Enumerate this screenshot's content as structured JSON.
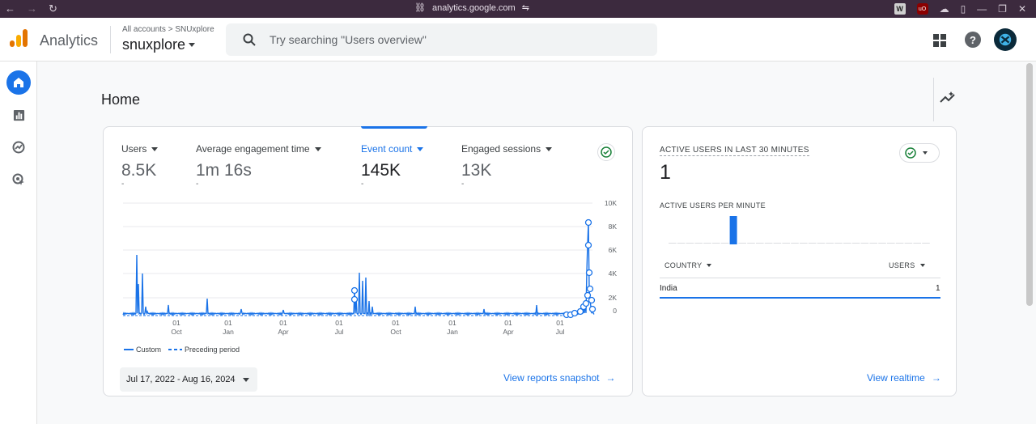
{
  "browser": {
    "url": "analytics.google.com",
    "ext_w": "W",
    "ext_ub": "uO"
  },
  "app": {
    "name": "Analytics",
    "breadcrumb": "All accounts > SNUxplore",
    "account": "snuxplore"
  },
  "search": {
    "placeholder": "Try searching \"Users overview\""
  },
  "page": {
    "title": "Home"
  },
  "metrics": [
    {
      "label": "Users",
      "value": "8.5K",
      "dash": "-"
    },
    {
      "label": "Average engagement time",
      "value": "1m 16s",
      "dash": "-"
    },
    {
      "label": "Event count",
      "value": "145K",
      "dash": "-"
    },
    {
      "label": "Engaged sessions",
      "value": "13K",
      "dash": "-"
    }
  ],
  "chart_data": {
    "type": "line",
    "y_ticks": [
      "10K",
      "8K",
      "6K",
      "4K",
      "2K",
      "0"
    ],
    "x_ticks": [
      {
        "day": "01",
        "month": "Oct"
      },
      {
        "day": "01",
        "month": "Jan"
      },
      {
        "day": "01",
        "month": "Apr"
      },
      {
        "day": "01",
        "month": "Jul"
      },
      {
        "day": "01",
        "month": "Oct"
      },
      {
        "day": "01",
        "month": "Jan"
      },
      {
        "day": "01",
        "month": "Apr"
      },
      {
        "day": "01",
        "month": "Jul"
      }
    ],
    "ylim": [
      0,
      10000
    ],
    "series": [
      {
        "name": "Custom",
        "style": "solid",
        "color": "#1a73e8"
      },
      {
        "name": "Preceding period",
        "style": "dashed",
        "color": "#1a73e8"
      }
    ]
  },
  "date_range": "Jul 17, 2022 - Aug 16, 2024",
  "links": {
    "snapshot": "View reports snapshot",
    "realtime": "View realtime"
  },
  "realtime": {
    "title": "ACTIVE USERS IN LAST 30 MINUTES",
    "value": "1",
    "per_minute_label": "ACTIVE USERS PER MINUTE",
    "col_country": "COUNTRY",
    "col_users": "USERS",
    "rows": [
      {
        "country": "India",
        "users": "1"
      }
    ]
  },
  "colors": {
    "accent": "#1a73e8",
    "check": "#188038"
  }
}
